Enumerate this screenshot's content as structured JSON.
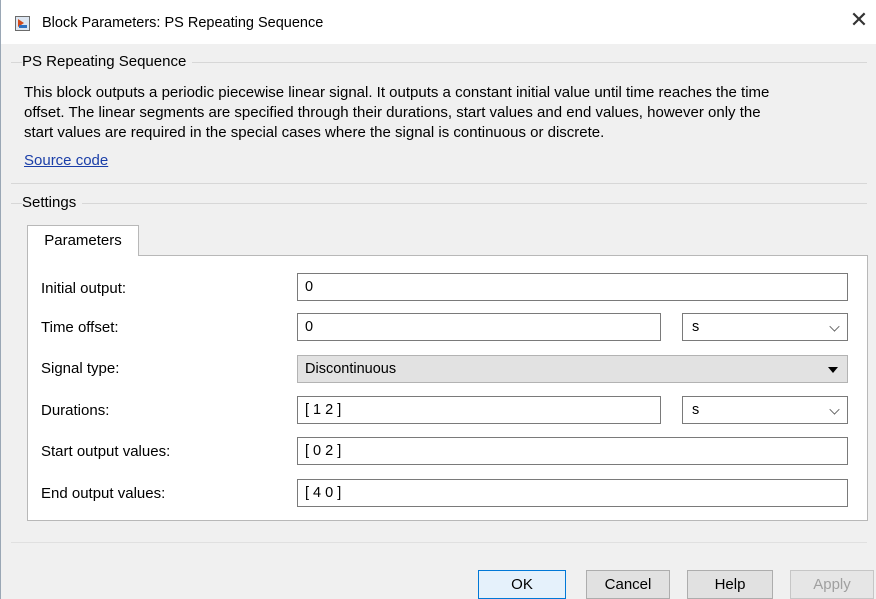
{
  "window": {
    "title": "Block Parameters: PS Repeating Sequence",
    "close_glyph": "✕"
  },
  "block": {
    "heading": "PS Repeating Sequence",
    "description_lines": [
      "This block outputs a periodic piecewise linear signal. It outputs a constant initial value until time reaches the time",
      "offset. The linear segments are specified through their durations, start values and end values, however only the",
      "start values are required in the special cases where the signal is continuous or discrete."
    ],
    "source_link": "Source code"
  },
  "settings": {
    "heading": "Settings",
    "tab_label": "Parameters",
    "params": {
      "initial_output": {
        "label": "Initial output:",
        "value": "0"
      },
      "time_offset": {
        "label": "Time offset:",
        "value": "0",
        "unit": "s"
      },
      "signal_type": {
        "label": "Signal type:",
        "value": "Discontinuous"
      },
      "durations": {
        "label": "Durations:",
        "value": "[ 1 2 ]",
        "unit": "s"
      },
      "start_output_values": {
        "label": "Start output values:",
        "value": "[ 0 2 ]"
      },
      "end_output_values": {
        "label": "End output values:",
        "value": "[ 4 0 ]"
      }
    }
  },
  "buttons": {
    "ok": "OK",
    "cancel": "Cancel",
    "help": "Help",
    "apply": "Apply"
  },
  "icons": {
    "window_icon": "simulink-block-icon",
    "close": "close-icon",
    "combo_arrow": "chevron-down-icon",
    "dropdown_arrow": "triangle-down-icon"
  },
  "colors": {
    "link": "#1a3ea8",
    "default_button_border": "#0078d7",
    "dialog_bg": "#f0f0f0"
  }
}
